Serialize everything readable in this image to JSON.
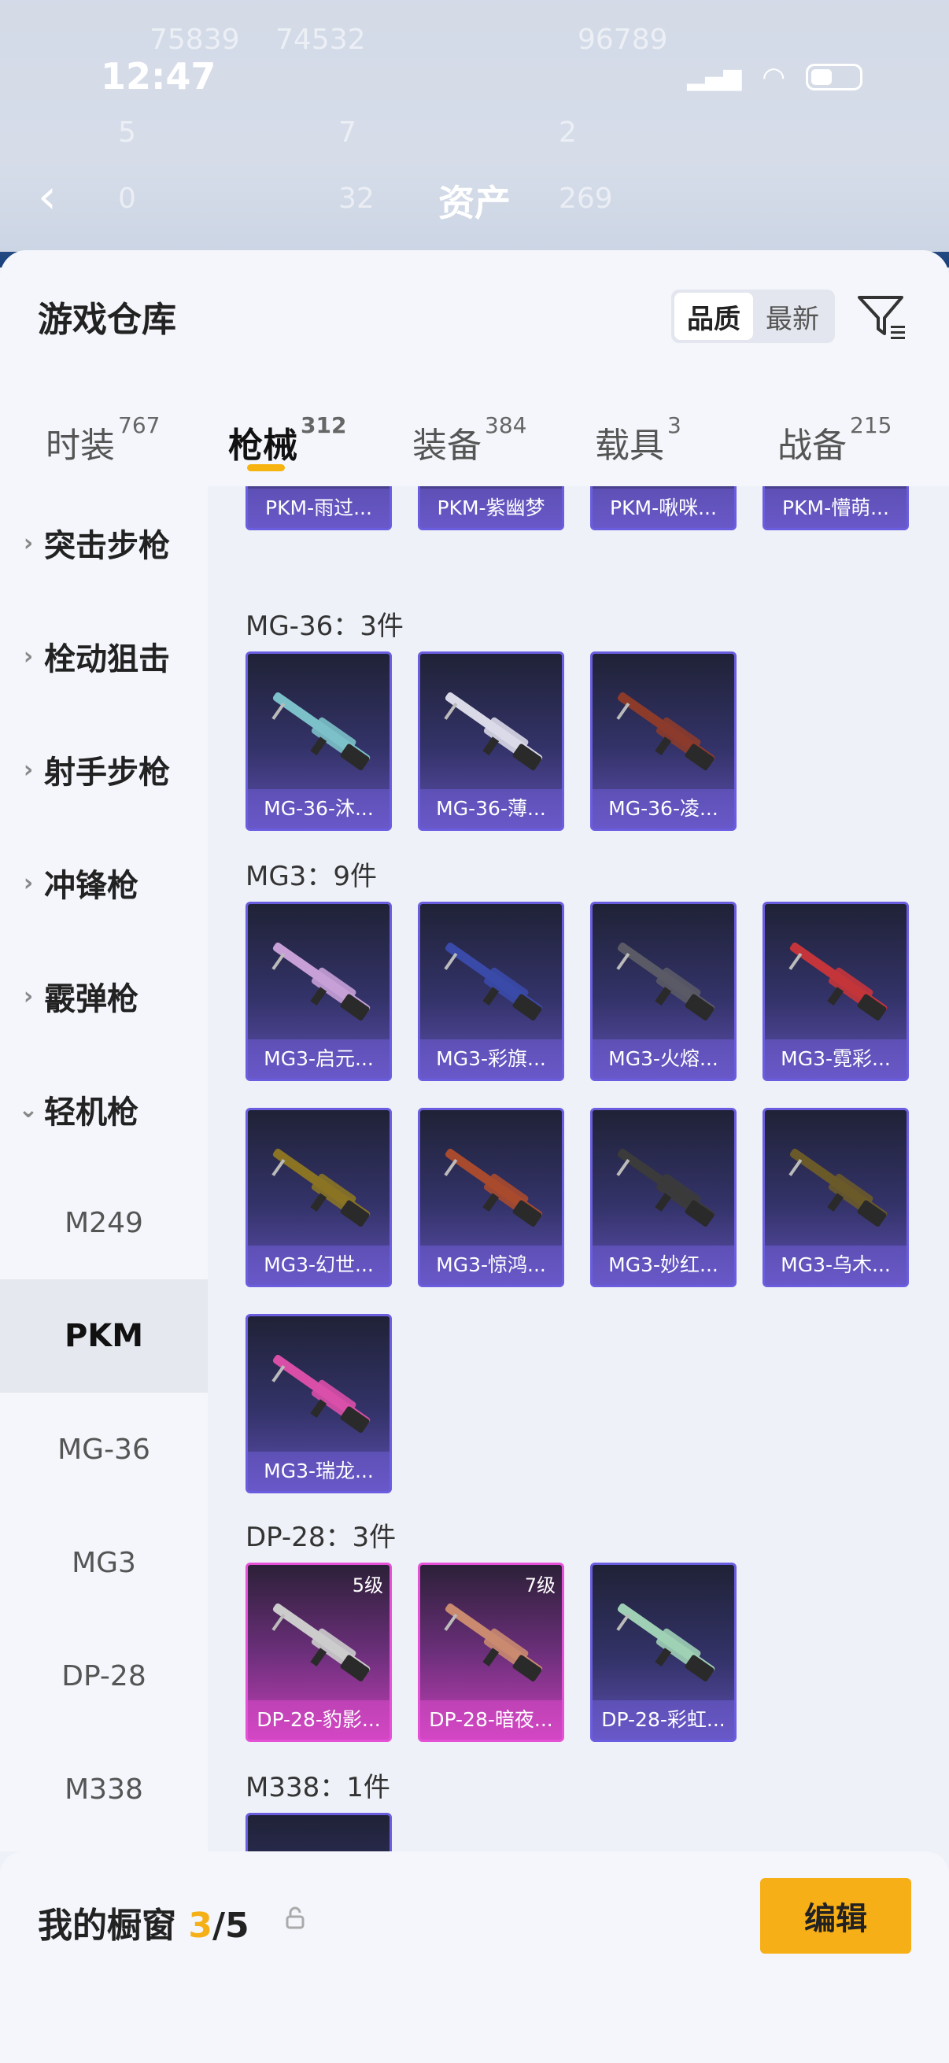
{
  "status_bar": {
    "time": "12:47"
  },
  "nav": {
    "title": "资产",
    "back_icon": "chevron-left-icon"
  },
  "bg_faint": [
    "75839",
    "74532",
    "96789",
    "5",
    "7",
    "2",
    "0",
    "32",
    "269"
  ],
  "sheet": {
    "title": "游戏仓库",
    "sort_options": [
      {
        "label": "品质",
        "active": true
      },
      {
        "label": "最新",
        "active": false
      }
    ],
    "filter_icon": "filter-icon"
  },
  "tabs": [
    {
      "label": "时装",
      "count": "767",
      "active": false
    },
    {
      "label": "枪械",
      "count": "312",
      "active": true
    },
    {
      "label": "装备",
      "count": "384",
      "active": false
    },
    {
      "label": "载具",
      "count": "3",
      "active": false
    },
    {
      "label": "战备",
      "count": "215",
      "active": false
    }
  ],
  "sidebar": {
    "categories": [
      "突击步枪",
      "栓动狙击",
      "射手步枪",
      "冲锋枪",
      "霰弹枪",
      "轻机枪"
    ],
    "subitems": [
      "M249",
      "PKM",
      "MG-36",
      "MG3",
      "DP-28",
      "M338"
    ],
    "selected_sub": "PKM"
  },
  "groups": [
    {
      "label": "",
      "items": [
        {
          "name": "PKM-雨过..."
        },
        {
          "name": "PKM-紫幽梦"
        },
        {
          "name": "PKM-啾咪..."
        },
        {
          "name": "PKM-懵萌..."
        }
      ]
    },
    {
      "label": "MG-36：3件",
      "items": [
        {
          "name": "MG-36-沐..."
        },
        {
          "name": "MG-36-薄..."
        },
        {
          "name": "MG-36-凌..."
        }
      ]
    },
    {
      "label": "MG3：9件",
      "items": [
        {
          "name": "MG3-启元..."
        },
        {
          "name": "MG3-彩旗..."
        },
        {
          "name": "MG3-火熔..."
        },
        {
          "name": "MG3-霓彩..."
        },
        {
          "name": "MG3-幻世..."
        },
        {
          "name": "MG3-惊鸿..."
        },
        {
          "name": "MG3-妙红..."
        },
        {
          "name": "MG3-乌木..."
        },
        {
          "name": "MG3-瑞龙..."
        }
      ]
    },
    {
      "label": "DP-28：3件",
      "items": [
        {
          "name": "DP-28-豹影...",
          "level": "5级",
          "rarity": "pink"
        },
        {
          "name": "DP-28-暗夜...",
          "level": "7级",
          "rarity": "pink"
        },
        {
          "name": "DP-28-彩虹..."
        }
      ]
    },
    {
      "label": "M338：1件",
      "items": [
        {
          "name": ""
        }
      ]
    }
  ],
  "fab": {
    "icon": "share-icon"
  },
  "footer": {
    "label": "我的橱窗",
    "count": "3",
    "total": "/5",
    "lock_icon": "lock-icon",
    "edit_label": "编辑"
  },
  "colors": {
    "accent": "#f7af17",
    "purple_card": "#5d4fb0",
    "pink_card": "#c43fb8"
  }
}
